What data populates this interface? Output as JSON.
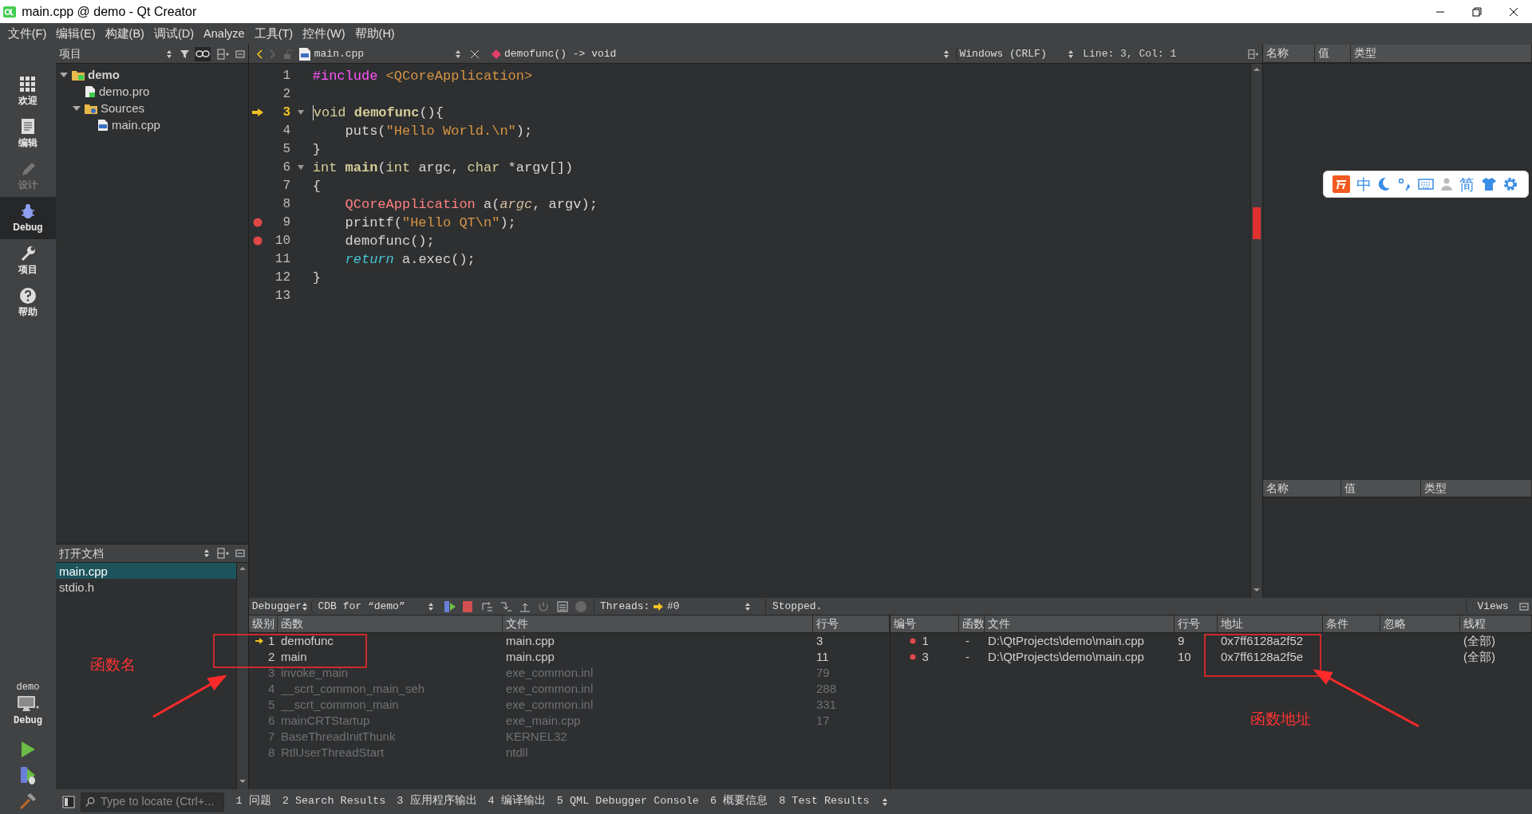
{
  "window": {
    "title": "main.cpp @ demo - Qt Creator"
  },
  "menu": [
    "文件(F)",
    "编辑(E)",
    "构建(B)",
    "调试(D)",
    "Analyze",
    "工具(T)",
    "控件(W)",
    "帮助(H)"
  ],
  "modes": [
    {
      "label": "欢迎",
      "kind": "grid",
      "selected": false,
      "disabled": false
    },
    {
      "label": "编辑",
      "kind": "document",
      "selected": false,
      "disabled": false
    },
    {
      "label": "设计",
      "kind": "pencil",
      "selected": false,
      "disabled": true
    },
    {
      "label": "Debug",
      "kind": "bug",
      "selected": true,
      "disabled": false
    },
    {
      "label": "项目",
      "kind": "wrench",
      "selected": false,
      "disabled": false
    },
    {
      "label": "帮助",
      "kind": "help",
      "selected": false,
      "disabled": false
    }
  ],
  "run_target": {
    "project": "demo",
    "config": "Debug"
  },
  "projects_panel": {
    "title": "项目",
    "tree": [
      {
        "label": "demo",
        "kind": "project",
        "expanded": true,
        "children": [
          {
            "label": "demo.pro",
            "kind": "profile"
          },
          {
            "label": "Sources",
            "kind": "folder",
            "expanded": true,
            "children": [
              {
                "label": "main.cpp",
                "kind": "cpp"
              }
            ]
          }
        ]
      }
    ]
  },
  "open_documents": {
    "title": "打开文档",
    "items": [
      {
        "label": "main.cpp",
        "selected": true
      },
      {
        "label": "stdio.h",
        "selected": false
      }
    ]
  },
  "editor": {
    "file": "main.cpp",
    "symbol": "demofunc() -> void",
    "line_ending": "Windows (CRLF)",
    "position": "Line: 3, Col: 1",
    "lines": [
      {
        "number": "1",
        "current": false,
        "breakpoint": false,
        "fold": false,
        "tokens": [
          {
            "kind": "preproc",
            "text": "#include"
          },
          {
            "kind": "include",
            "text": " <QCoreApplication>"
          }
        ]
      },
      {
        "number": "2",
        "current": false,
        "breakpoint": false,
        "fold": false
      },
      {
        "number": "3",
        "current": true,
        "breakpoint": false,
        "fold": true,
        "tokens": [
          {
            "kind": "keyword",
            "text": "void "
          },
          {
            "kind": "funcdef",
            "text": "demofunc"
          },
          {
            "kind": "plain",
            "text": "(){"
          }
        ]
      },
      {
        "number": "4",
        "current": false,
        "breakpoint": false,
        "fold": false,
        "tokens": [
          {
            "kind": "plain",
            "text": "    puts("
          },
          {
            "kind": "string",
            "text": "\"Hello World.\\n\""
          },
          {
            "kind": "plain",
            "text": ");"
          }
        ]
      },
      {
        "number": "5",
        "current": false,
        "breakpoint": false,
        "fold": false,
        "tokens": [
          {
            "kind": "plain",
            "text": "}"
          }
        ]
      },
      {
        "number": "6",
        "current": false,
        "breakpoint": false,
        "fold": true,
        "tokens": [
          {
            "kind": "keyword",
            "text": "int "
          },
          {
            "kind": "funcdef",
            "text": "main"
          },
          {
            "kind": "plain",
            "text": "("
          },
          {
            "kind": "keyword",
            "text": "int"
          },
          {
            "kind": "plain",
            "text": " argc, "
          },
          {
            "kind": "keyword",
            "text": "char"
          },
          {
            "kind": "plain",
            "text": " *argv[])"
          }
        ]
      },
      {
        "number": "7",
        "current": false,
        "breakpoint": false,
        "fold": false,
        "tokens": [
          {
            "kind": "plain",
            "text": "{"
          }
        ]
      },
      {
        "number": "8",
        "current": false,
        "breakpoint": false,
        "fold": false,
        "tokens": [
          {
            "kind": "type",
            "text": "    QCoreApplication"
          },
          {
            "kind": "plain",
            "text": " a("
          },
          {
            "kind": "param",
            "text": "argc"
          },
          {
            "kind": "plain",
            "text": ", argv);"
          }
        ]
      },
      {
        "number": "9",
        "current": false,
        "breakpoint": true,
        "fold": false,
        "tokens": [
          {
            "kind": "plain",
            "text": "    printf("
          },
          {
            "kind": "string",
            "text": "\"Hello QT\\n\""
          },
          {
            "kind": "plain",
            "text": ");"
          }
        ]
      },
      {
        "number": "10",
        "current": false,
        "breakpoint": true,
        "fold": false,
        "tokens": [
          {
            "kind": "plain",
            "text": "    demofunc();"
          }
        ]
      },
      {
        "number": "11",
        "current": false,
        "breakpoint": false,
        "fold": false,
        "tokens": [
          {
            "kind": "flow",
            "text": "    return"
          },
          {
            "kind": "plain",
            "text": " a.exec();"
          }
        ]
      },
      {
        "number": "12",
        "current": false,
        "breakpoint": false,
        "fold": false,
        "tokens": [
          {
            "kind": "plain",
            "text": "}"
          }
        ]
      },
      {
        "number": "13",
        "current": false,
        "breakpoint": false,
        "fold": false
      }
    ]
  },
  "locals": {
    "columns": [
      "名称",
      "值",
      "类型"
    ]
  },
  "inspector": {
    "columns": [
      "名称",
      "值",
      "类型"
    ]
  },
  "ime_toolbar": {
    "mode": "中",
    "script": "简"
  },
  "debugger": {
    "perspective": "Debugger",
    "engine": "CDB for “demo”",
    "threads_label": "Threads:",
    "thread": "#0",
    "status": "Stopped.",
    "views": "Views",
    "stack": {
      "columns": [
        "级别",
        "函数",
        "文件",
        "行号"
      ],
      "rows": [
        {
          "level": "1",
          "function": "demofunc",
          "file": "main.cpp",
          "line": "3",
          "current": true,
          "disabled": false
        },
        {
          "level": "2",
          "function": "main",
          "file": "main.cpp",
          "line": "11",
          "current": false,
          "disabled": false
        },
        {
          "level": "3",
          "function": "invoke_main",
          "file": "exe_common.inl",
          "line": "79",
          "current": false,
          "disabled": true
        },
        {
          "level": "4",
          "function": "__scrt_common_main_seh",
          "file": "exe_common.inl",
          "line": "288",
          "current": false,
          "disabled": true
        },
        {
          "level": "5",
          "function": "__scrt_common_main",
          "file": "exe_common.inl",
          "line": "331",
          "current": false,
          "disabled": true
        },
        {
          "level": "6",
          "function": "mainCRTStartup",
          "file": "exe_main.cpp",
          "line": "17",
          "current": false,
          "disabled": true
        },
        {
          "level": "7",
          "function": "BaseThreadInitThunk",
          "file": "KERNEL32",
          "current": false,
          "disabled": true
        },
        {
          "level": "8",
          "function": "RtlUserThreadStart",
          "file": "ntdll",
          "current": false,
          "disabled": true
        }
      ]
    },
    "breakpoints": {
      "columns": [
        "编号",
        "函数",
        "文件",
        "行号",
        "地址",
        "条件",
        "忽略",
        "线程"
      ],
      "rows": [
        {
          "number": "1",
          "function": "-",
          "file": "D:\\QtProjects\\demo\\main.cpp",
          "line": "9",
          "address": "0x7ff6128a2f52",
          "threads": "(全部)"
        },
        {
          "number": "3",
          "function": "-",
          "file": "D:\\QtProjects\\demo\\main.cpp",
          "line": "10",
          "address": "0x7ff6128a2f5e",
          "threads": "(全部)"
        }
      ]
    }
  },
  "locator": {
    "placeholder": "Type to locate (Ctrl+..."
  },
  "output_tabs": [
    "1 问题",
    "2 Search Results",
    "3 应用程序输出",
    "4 编译输出",
    "5 QML Debugger Console",
    "6 概要信息",
    "8 Test Results"
  ],
  "annotations": [
    {
      "text": "函数名"
    },
    {
      "text": "函数地址"
    }
  ]
}
